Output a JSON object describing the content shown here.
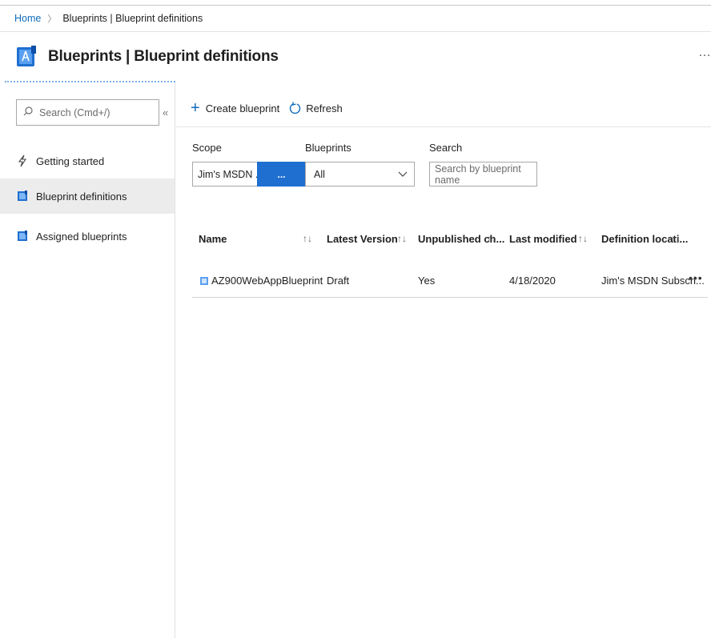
{
  "breadcrumb": {
    "home": "Home",
    "current": "Blueprints | Blueprint definitions"
  },
  "page": {
    "title": "Blueprints | Blueprint definitions",
    "more": "…"
  },
  "sidebar": {
    "search_placeholder": "Search (Cmd+/)",
    "collapse": "«",
    "items": [
      {
        "label": "Getting started",
        "icon": "lightning-icon",
        "active": false
      },
      {
        "label": "Blueprint definitions",
        "icon": "blueprint-icon",
        "active": true
      },
      {
        "label": "Assigned blueprints",
        "icon": "blueprint-icon",
        "active": false
      }
    ]
  },
  "toolbar": {
    "create_label": "Create blueprint",
    "refresh_label": "Refresh"
  },
  "filters": {
    "scope_label": "Scope",
    "scope_value": "Jim's MSDN ...",
    "scope_button": "...",
    "blueprints_label": "Blueprints",
    "blueprints_value": "All",
    "search_label": "Search",
    "search_placeholder": "Search by blueprint name"
  },
  "table": {
    "columns": [
      "Name",
      "Latest Version",
      "Unpublished ch...",
      "Last modified",
      "Definition locati..."
    ],
    "rows": [
      {
        "name": "AZ900WebAppBlueprint",
        "latest_version": "Draft",
        "unpublished_changes": "Yes",
        "last_modified": "4/18/2020",
        "definition_location": "Jim's MSDN Subscri...",
        "more": "•••"
      }
    ]
  },
  "colors": {
    "accent": "#1e6fd0",
    "link": "#0f6cbd",
    "active_nav_bg": "#ececec"
  }
}
